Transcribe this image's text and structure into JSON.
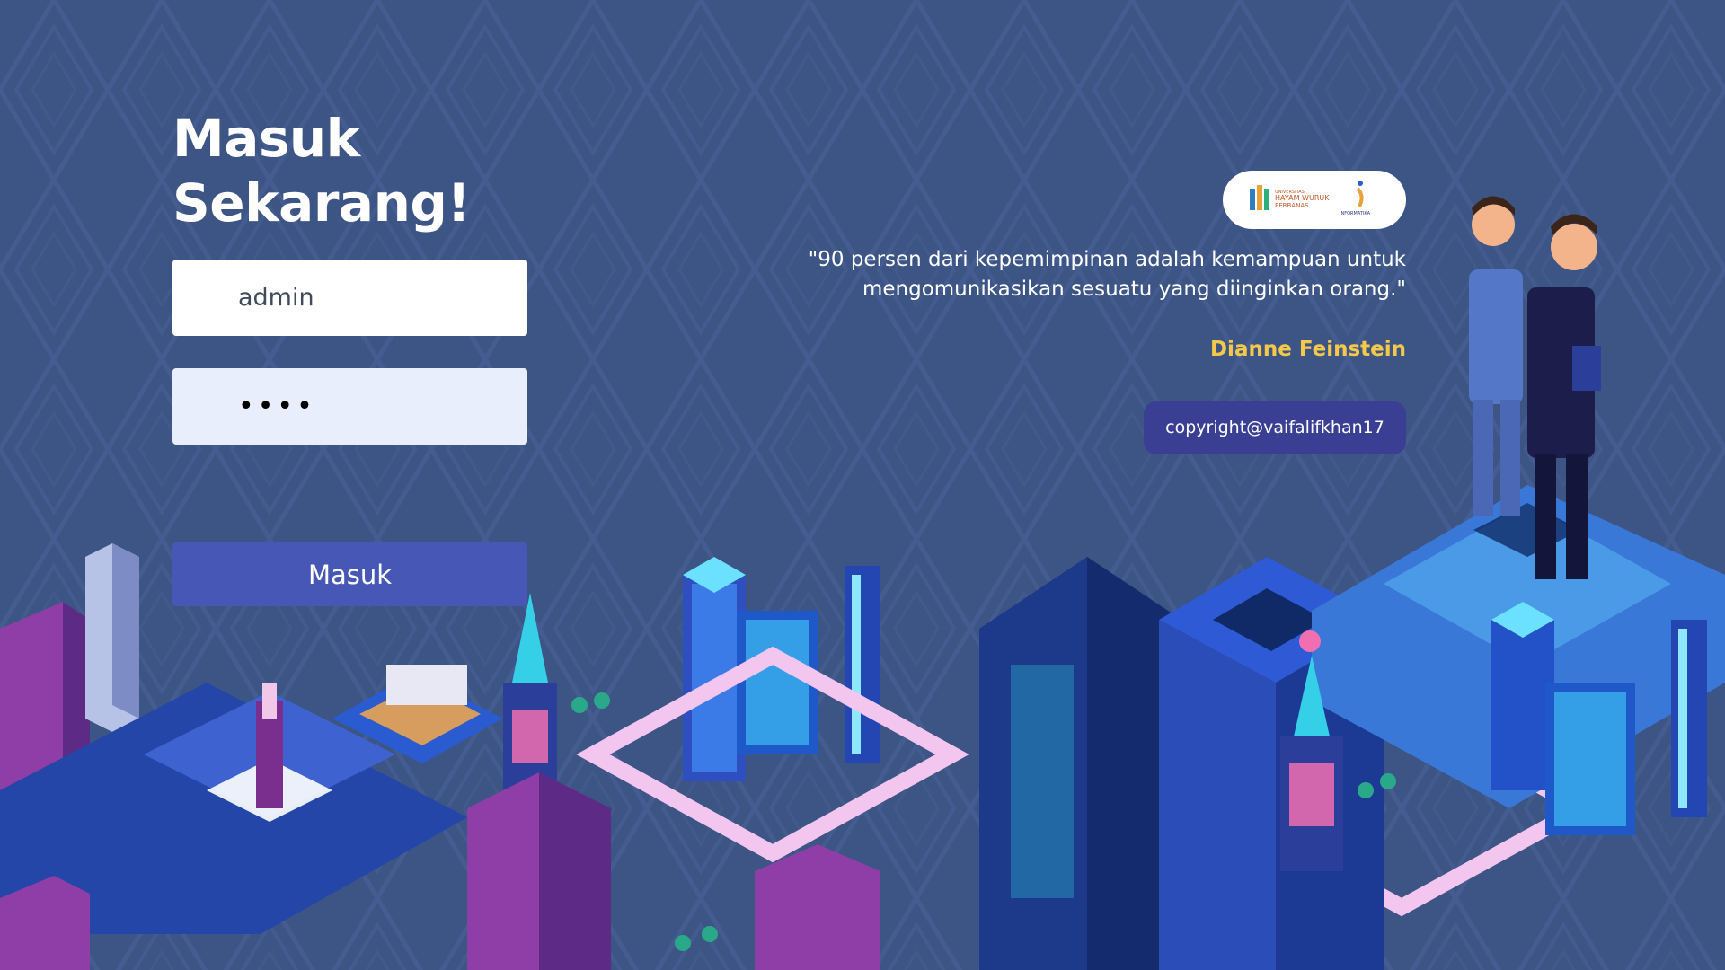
{
  "login": {
    "heading_line1": "Masuk",
    "heading_line2": "Sekarang!",
    "username_value": "admin",
    "password_value": "••••",
    "submit_label": "Masuk"
  },
  "logos": {
    "university_line1": "UNIVERSITAS",
    "university_line2": "HAYAM WURUK",
    "university_line3": "PERBANAS",
    "department": "INFORMATIKA"
  },
  "quote": {
    "text": "\"90 persen dari kepemimpinan adalah kemampuan untuk mengomunikasikan sesuatu yang diinginkan orang.\"",
    "author": "Dianne Feinstein"
  },
  "footer": {
    "copyright": "copyright@vaifalifkhan17"
  },
  "colors": {
    "background": "#3d5585",
    "button": "#4657b5",
    "author": "#f4c84a",
    "copyright_badge": "#3a3f93"
  }
}
